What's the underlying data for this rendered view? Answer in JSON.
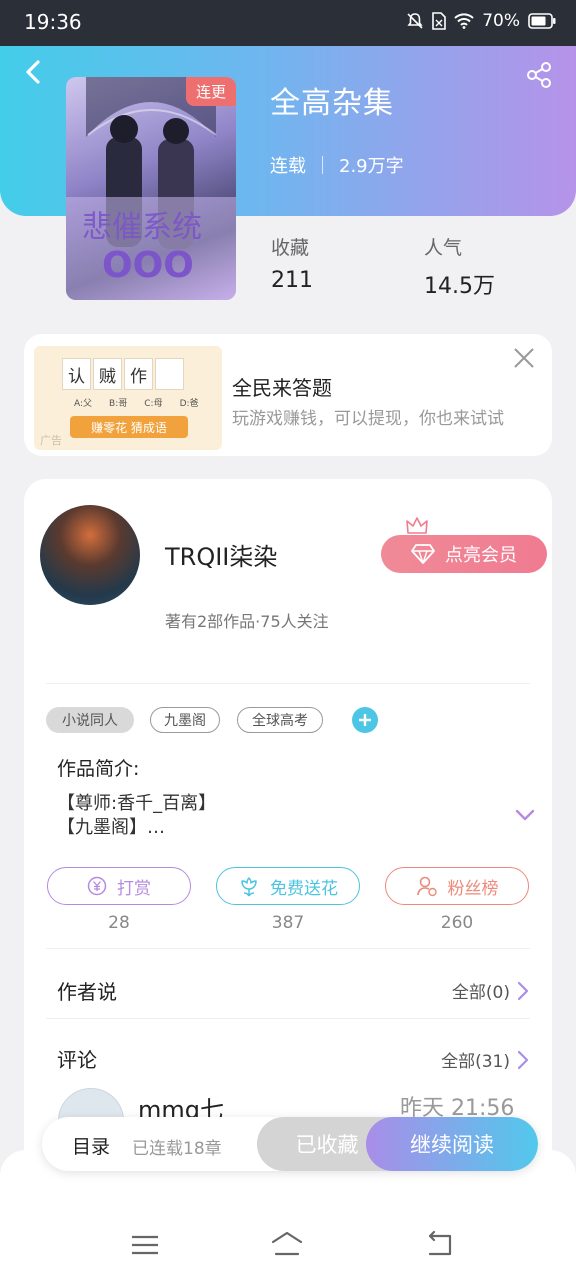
{
  "status_bar": {
    "time": "19:36",
    "battery": "70%"
  },
  "book": {
    "title": "全高杂集",
    "serial_badge": "连更",
    "status": "连载",
    "word_count": "2.9万字",
    "stats": [
      {
        "label": "收藏",
        "value": "211"
      },
      {
        "label": "人气",
        "value": "14.5万"
      }
    ]
  },
  "ad": {
    "tiles": [
      "认",
      "贼",
      "作",
      ""
    ],
    "options": [
      "A:父",
      "B:哥",
      "C:母",
      "D:爸"
    ],
    "button": "赚零花 猜成语",
    "tag": "广告",
    "title": "全民来答题",
    "subtitle": "玩游戏赚钱，可以提现，你也来试试"
  },
  "author": {
    "name": "TRQII柒染",
    "vip_button": "点亮会员",
    "meta": "著有2部作品·75人关注"
  },
  "tags": [
    "小说同人",
    "九墨阁",
    "全球高考"
  ],
  "intro": {
    "label": "作品简介:",
    "text": "【尊师:香千_百离】\n【九墨阁】…"
  },
  "actions": [
    {
      "label": "打赏",
      "count": "28",
      "color": "#b58be0"
    },
    {
      "label": "免费送花",
      "count": "387",
      "color": "#4cc4e0"
    },
    {
      "label": "粉丝榜",
      "count": "260",
      "color": "#ec8a7c"
    }
  ],
  "author_says": {
    "title": "作者说",
    "link": "全部(0)"
  },
  "comments": {
    "title": "评论",
    "link": "全部(31)",
    "first": {
      "user": "mmq七",
      "time": "昨天 21:56"
    }
  },
  "bottom_bar": {
    "toc": "目录",
    "chapters": "已连载18章",
    "favorited": "已收藏",
    "continue": "继续阅读"
  },
  "colors": {
    "accent_purple": "#a98de8",
    "accent_cyan": "#52c8ec",
    "vip_pink": "#f07b92"
  }
}
